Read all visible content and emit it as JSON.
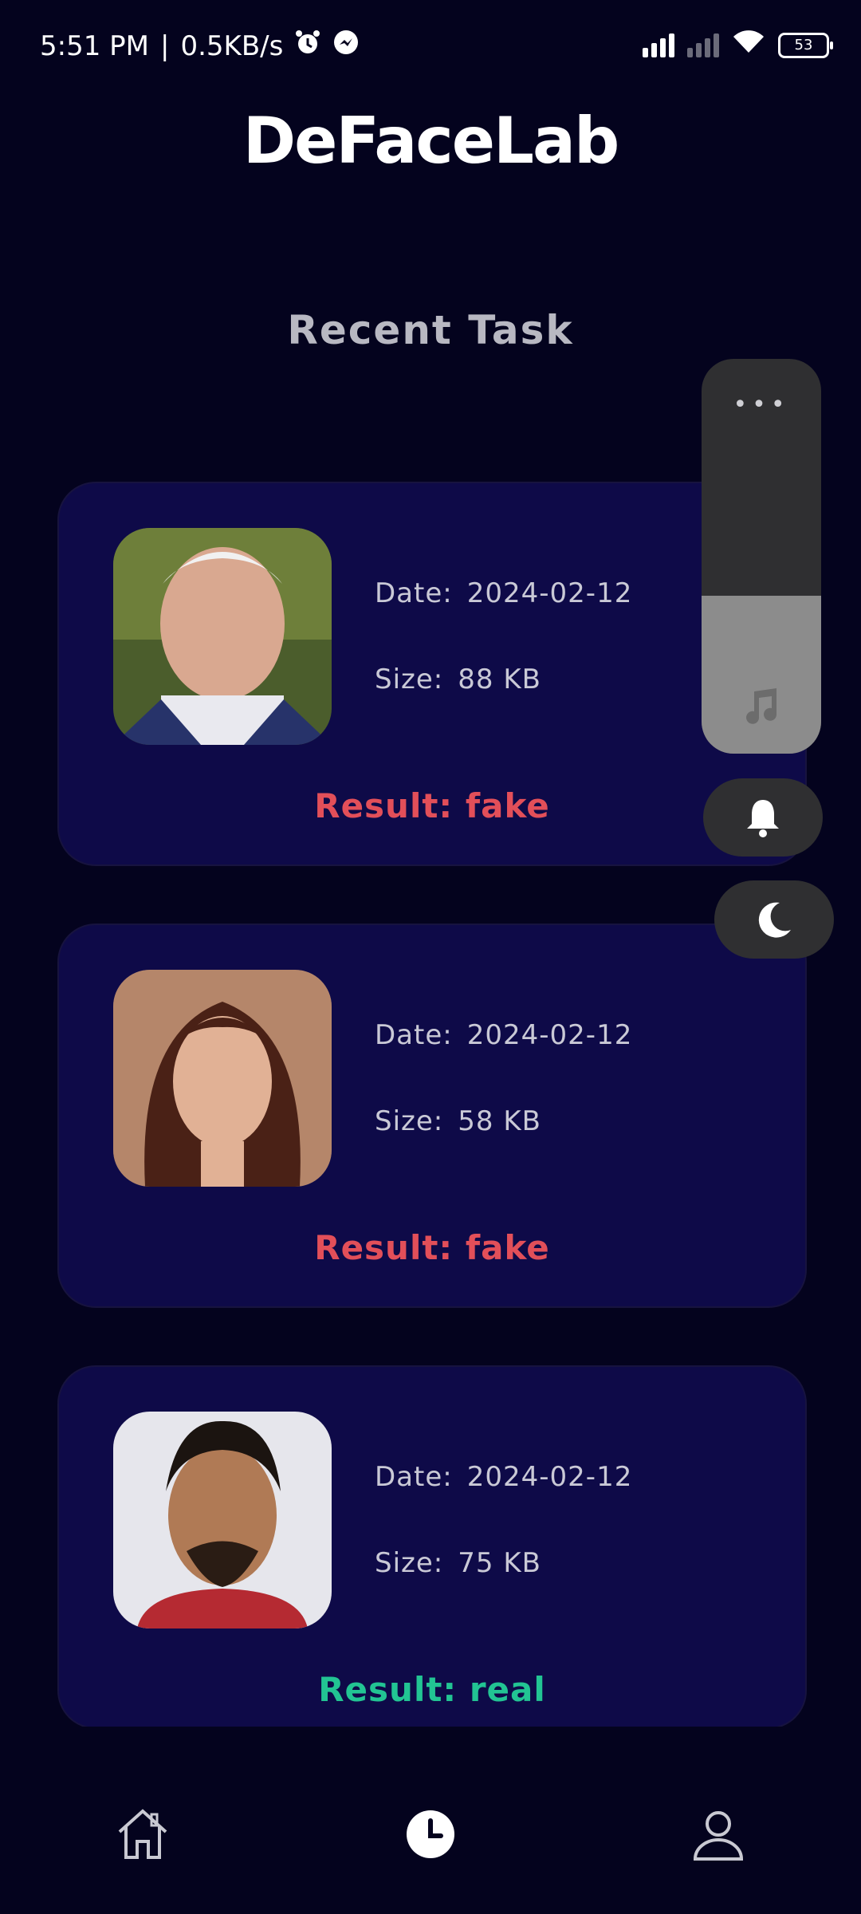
{
  "status": {
    "time": "5:51 PM",
    "network_speed": "0.5KB/s",
    "battery": "53"
  },
  "app": {
    "title": "DeFaceLab"
  },
  "section": {
    "title": "Recent Task"
  },
  "tasks": [
    {
      "date_label": "Date:",
      "date": "2024-02-12",
      "size_label": "Size:",
      "size": "88 KB",
      "result_label": "Result:",
      "result": "fake",
      "result_color": "#e24f59"
    },
    {
      "date_label": "Date:",
      "date": "2024-02-12",
      "size_label": "Size:",
      "size": "58 KB",
      "result_label": "Result:",
      "result": "fake",
      "result_color": "#e24f59"
    },
    {
      "date_label": "Date:",
      "date": "2024-02-12",
      "size_label": "Size:",
      "size": "75 KB",
      "result_label": "Result:",
      "result": "real",
      "result_color": "#22c493"
    }
  ],
  "quick_controls": {
    "more_icon": "more-dots-icon",
    "volume_icon": "music-note-icon",
    "ring_icon": "bell-icon",
    "dnd_icon": "moon-icon",
    "volume_level_fraction": 0.4
  },
  "nav": {
    "items": [
      "home-icon",
      "history-clock-icon",
      "profile-icon"
    ],
    "active": "history-clock-icon"
  },
  "colors": {
    "background": "#04031e",
    "card": "#0e0a48",
    "fake": "#e24f59",
    "real": "#22c493"
  }
}
